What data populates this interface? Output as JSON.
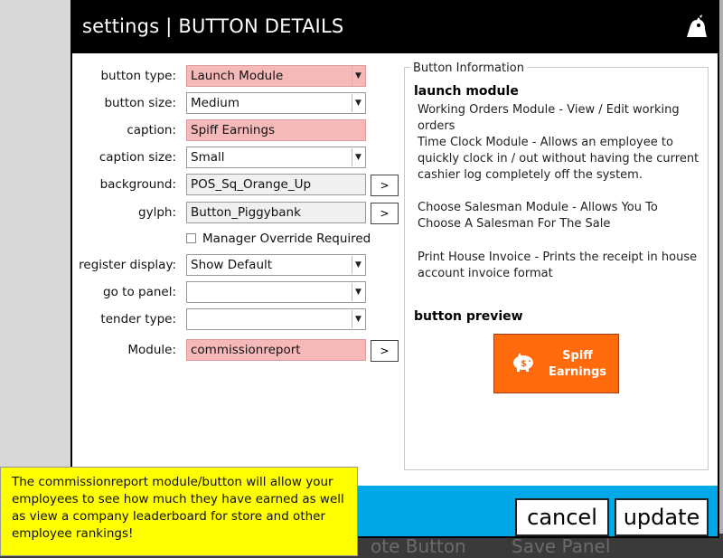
{
  "dialog": {
    "title": "settings | BUTTON DETAILS"
  },
  "form": {
    "button_type": {
      "label": "button type:",
      "value": "Launch Module"
    },
    "button_size": {
      "label": "button size:",
      "value": "Medium"
    },
    "caption": {
      "label": "caption:",
      "value": "Spiff Earnings"
    },
    "caption_size": {
      "label": "caption size:",
      "value": "Small"
    },
    "background": {
      "label": "background:",
      "value": "POS_Sq_Orange_Up",
      "browse": ">"
    },
    "gylph": {
      "label": "gylph:",
      "value": "Button_Piggybank",
      "browse": ">"
    },
    "manager_override": {
      "label": "Manager Override Required",
      "checked": false
    },
    "register_display": {
      "label": "register display:",
      "value": "Show Default"
    },
    "go_to_panel": {
      "label": "go to panel:",
      "value": ""
    },
    "tender_type": {
      "label": "tender type:",
      "value": ""
    },
    "module": {
      "label": "Module:",
      "value": "commissionreport",
      "browse": ">"
    }
  },
  "info": {
    "legend": "Button Information",
    "heading": "launch module",
    "lines": [
      "Working Orders Module - View / Edit working orders",
      "Time Clock Module - Allows an employee to quickly clock in / out without having the current cashier log completely off the system.",
      "Choose Salesman Module - Allows You To Choose A Salesman For The Sale",
      "Print House Invoice - Prints the receipt in house account invoice format"
    ],
    "preview_heading": "button preview",
    "preview_caption": "Spiff Earnings",
    "preview_color": "#ff6a0d",
    "preview_icon": "piggybank-icon"
  },
  "footer": {
    "cancel": "cancel",
    "update": "update",
    "color": "#00a8e8"
  },
  "background_app": {
    "left_text": "ote Button",
    "right_text": "Save Panel"
  },
  "tooltip": {
    "text": "The commissionreport module/button will allow your employees to see how much they have earned as well as view a company leaderboard for store and other employee rankings!"
  }
}
